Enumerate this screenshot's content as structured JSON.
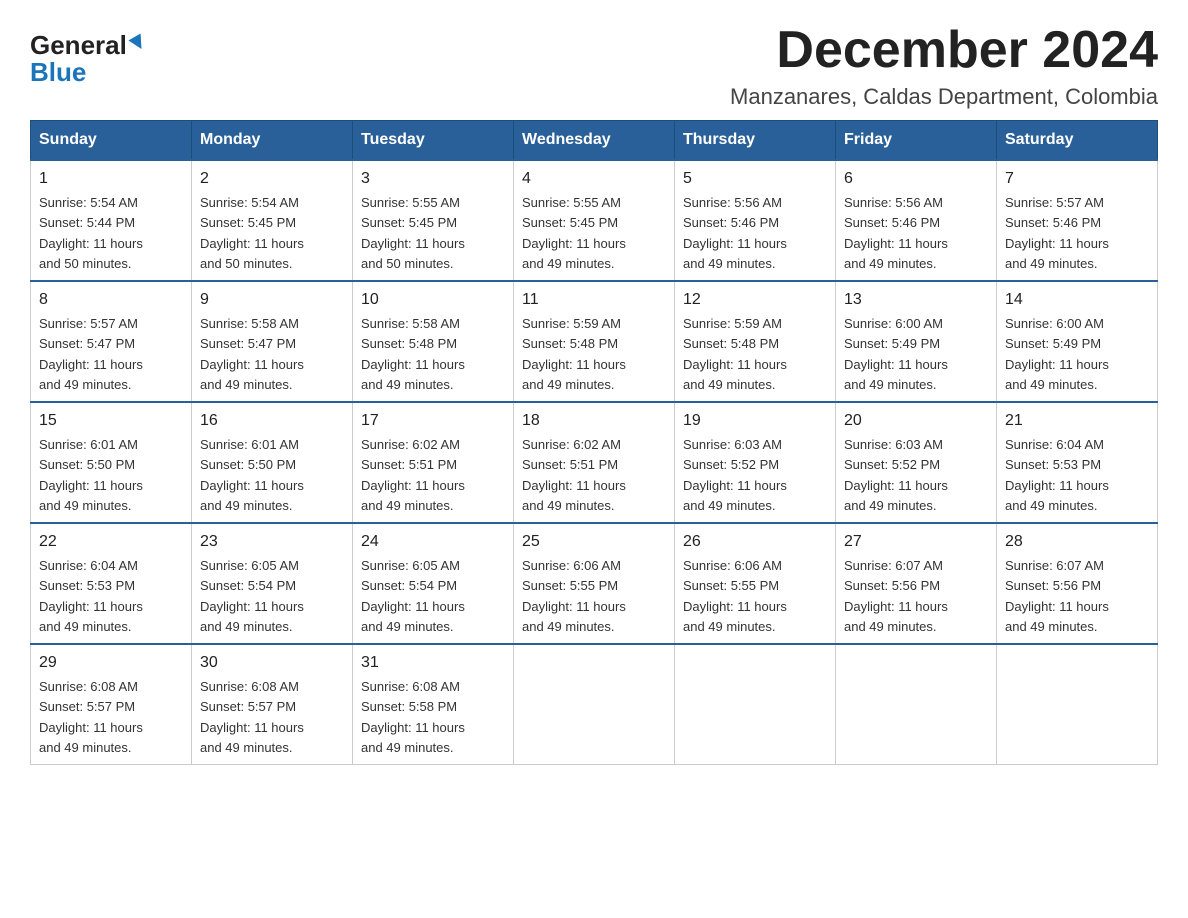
{
  "logo": {
    "general": "General",
    "blue": "Blue"
  },
  "header": {
    "month": "December 2024",
    "location": "Manzanares, Caldas Department, Colombia"
  },
  "weekdays": [
    "Sunday",
    "Monday",
    "Tuesday",
    "Wednesday",
    "Thursday",
    "Friday",
    "Saturday"
  ],
  "weeks": [
    [
      {
        "day": "1",
        "sunrise": "5:54 AM",
        "sunset": "5:44 PM",
        "daylight": "11 hours and 50 minutes."
      },
      {
        "day": "2",
        "sunrise": "5:54 AM",
        "sunset": "5:45 PM",
        "daylight": "11 hours and 50 minutes."
      },
      {
        "day": "3",
        "sunrise": "5:55 AM",
        "sunset": "5:45 PM",
        "daylight": "11 hours and 50 minutes."
      },
      {
        "day": "4",
        "sunrise": "5:55 AM",
        "sunset": "5:45 PM",
        "daylight": "11 hours and 49 minutes."
      },
      {
        "day": "5",
        "sunrise": "5:56 AM",
        "sunset": "5:46 PM",
        "daylight": "11 hours and 49 minutes."
      },
      {
        "day": "6",
        "sunrise": "5:56 AM",
        "sunset": "5:46 PM",
        "daylight": "11 hours and 49 minutes."
      },
      {
        "day": "7",
        "sunrise": "5:57 AM",
        "sunset": "5:46 PM",
        "daylight": "11 hours and 49 minutes."
      }
    ],
    [
      {
        "day": "8",
        "sunrise": "5:57 AM",
        "sunset": "5:47 PM",
        "daylight": "11 hours and 49 minutes."
      },
      {
        "day": "9",
        "sunrise": "5:58 AM",
        "sunset": "5:47 PM",
        "daylight": "11 hours and 49 minutes."
      },
      {
        "day": "10",
        "sunrise": "5:58 AM",
        "sunset": "5:48 PM",
        "daylight": "11 hours and 49 minutes."
      },
      {
        "day": "11",
        "sunrise": "5:59 AM",
        "sunset": "5:48 PM",
        "daylight": "11 hours and 49 minutes."
      },
      {
        "day": "12",
        "sunrise": "5:59 AM",
        "sunset": "5:48 PM",
        "daylight": "11 hours and 49 minutes."
      },
      {
        "day": "13",
        "sunrise": "6:00 AM",
        "sunset": "5:49 PM",
        "daylight": "11 hours and 49 minutes."
      },
      {
        "day": "14",
        "sunrise": "6:00 AM",
        "sunset": "5:49 PM",
        "daylight": "11 hours and 49 minutes."
      }
    ],
    [
      {
        "day": "15",
        "sunrise": "6:01 AM",
        "sunset": "5:50 PM",
        "daylight": "11 hours and 49 minutes."
      },
      {
        "day": "16",
        "sunrise": "6:01 AM",
        "sunset": "5:50 PM",
        "daylight": "11 hours and 49 minutes."
      },
      {
        "day": "17",
        "sunrise": "6:02 AM",
        "sunset": "5:51 PM",
        "daylight": "11 hours and 49 minutes."
      },
      {
        "day": "18",
        "sunrise": "6:02 AM",
        "sunset": "5:51 PM",
        "daylight": "11 hours and 49 minutes."
      },
      {
        "day": "19",
        "sunrise": "6:03 AM",
        "sunset": "5:52 PM",
        "daylight": "11 hours and 49 minutes."
      },
      {
        "day": "20",
        "sunrise": "6:03 AM",
        "sunset": "5:52 PM",
        "daylight": "11 hours and 49 minutes."
      },
      {
        "day": "21",
        "sunrise": "6:04 AM",
        "sunset": "5:53 PM",
        "daylight": "11 hours and 49 minutes."
      }
    ],
    [
      {
        "day": "22",
        "sunrise": "6:04 AM",
        "sunset": "5:53 PM",
        "daylight": "11 hours and 49 minutes."
      },
      {
        "day": "23",
        "sunrise": "6:05 AM",
        "sunset": "5:54 PM",
        "daylight": "11 hours and 49 minutes."
      },
      {
        "day": "24",
        "sunrise": "6:05 AM",
        "sunset": "5:54 PM",
        "daylight": "11 hours and 49 minutes."
      },
      {
        "day": "25",
        "sunrise": "6:06 AM",
        "sunset": "5:55 PM",
        "daylight": "11 hours and 49 minutes."
      },
      {
        "day": "26",
        "sunrise": "6:06 AM",
        "sunset": "5:55 PM",
        "daylight": "11 hours and 49 minutes."
      },
      {
        "day": "27",
        "sunrise": "6:07 AM",
        "sunset": "5:56 PM",
        "daylight": "11 hours and 49 minutes."
      },
      {
        "day": "28",
        "sunrise": "6:07 AM",
        "sunset": "5:56 PM",
        "daylight": "11 hours and 49 minutes."
      }
    ],
    [
      {
        "day": "29",
        "sunrise": "6:08 AM",
        "sunset": "5:57 PM",
        "daylight": "11 hours and 49 minutes."
      },
      {
        "day": "30",
        "sunrise": "6:08 AM",
        "sunset": "5:57 PM",
        "daylight": "11 hours and 49 minutes."
      },
      {
        "day": "31",
        "sunrise": "6:08 AM",
        "sunset": "5:58 PM",
        "daylight": "11 hours and 49 minutes."
      },
      null,
      null,
      null,
      null
    ]
  ],
  "labels": {
    "sunrise": "Sunrise:",
    "sunset": "Sunset:",
    "daylight": "Daylight:"
  }
}
